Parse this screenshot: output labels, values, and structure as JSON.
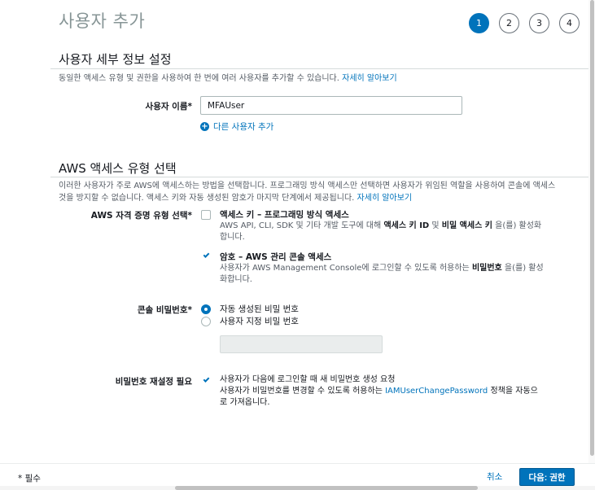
{
  "header": {
    "title": "사용자 추가",
    "steps": [
      "1",
      "2",
      "3",
      "4"
    ],
    "active_step": "1"
  },
  "user_details": {
    "title": "사용자 세부 정보 설정",
    "description": "동일한 액세스 유형 및 권한을 사용하여 한 번에 여러 사용자를 추가할 수 있습니다.",
    "learn_more": "자세히 알아보기",
    "username_label": "사용자 이름*",
    "username_value": "MFAUser",
    "add_user_label": "다른 사용자 추가"
  },
  "access_type": {
    "title": "AWS 액세스 유형 선택",
    "description_line1": "이러한 사용자가 주로 AWS에 액세스하는 방법을 선택합니다. 프로그래밍 방식 액세스만 선택하면 사용자가 위임된 역할을 사용하여 콘솔에 액세스",
    "description_line2": "것을 방지할 수 없습니다. 액세스 키와 자동 생성된 암호가 마지막 단계에서 제공됩니다.",
    "learn_more": "자세히 알아보기",
    "credential_label": "AWS 자격 증명 유형 선택*",
    "programmatic": {
      "title": "액세스 키 – 프로그래밍 방식 액세스",
      "desc_part1": "AWS API, CLI, SDK 및 기타 개발 도구에 대해 ",
      "desc_bold1": "액세스 키 ID",
      "desc_part2": " 및 ",
      "desc_bold2": "비밀 액세스 키",
      "desc_part3": " 을(를) 활성화합니다.",
      "checked": false
    },
    "console": {
      "title": "암호 – AWS 관리 콘솔 액세스",
      "desc_part1": "사용자가 AWS Management Console에 로그인할 수 있도록 허용하는 ",
      "desc_bold1": "비밀번호",
      "desc_part2": " 을(를) 활성화합니다.",
      "checked": true
    }
  },
  "console_password": {
    "label": "콘솔 비밀번호*",
    "auto_option": "자동 생성된 비밀 번호",
    "custom_option": "사용자 지정 비밀 번호",
    "selected": "auto"
  },
  "password_reset": {
    "label": "비밀번호 재설정 필요",
    "checked": true,
    "line1": "사용자가 다음에 로그인할 때 새 비밀번호 생성 요청",
    "line2_part1": "사용자가 비밀번호를 변경할 수 있도록 허용하는 ",
    "line2_link": "IAMUserChangePassword",
    "line2_part2": " 정책을 자동으로 가져옵니다."
  },
  "footer": {
    "required_note": "* 필수",
    "cancel_label": "취소",
    "next_label": "다음: 권한"
  },
  "colors": {
    "accent": "#0073bb",
    "title_gray": "#879596",
    "text": "#16191f"
  }
}
